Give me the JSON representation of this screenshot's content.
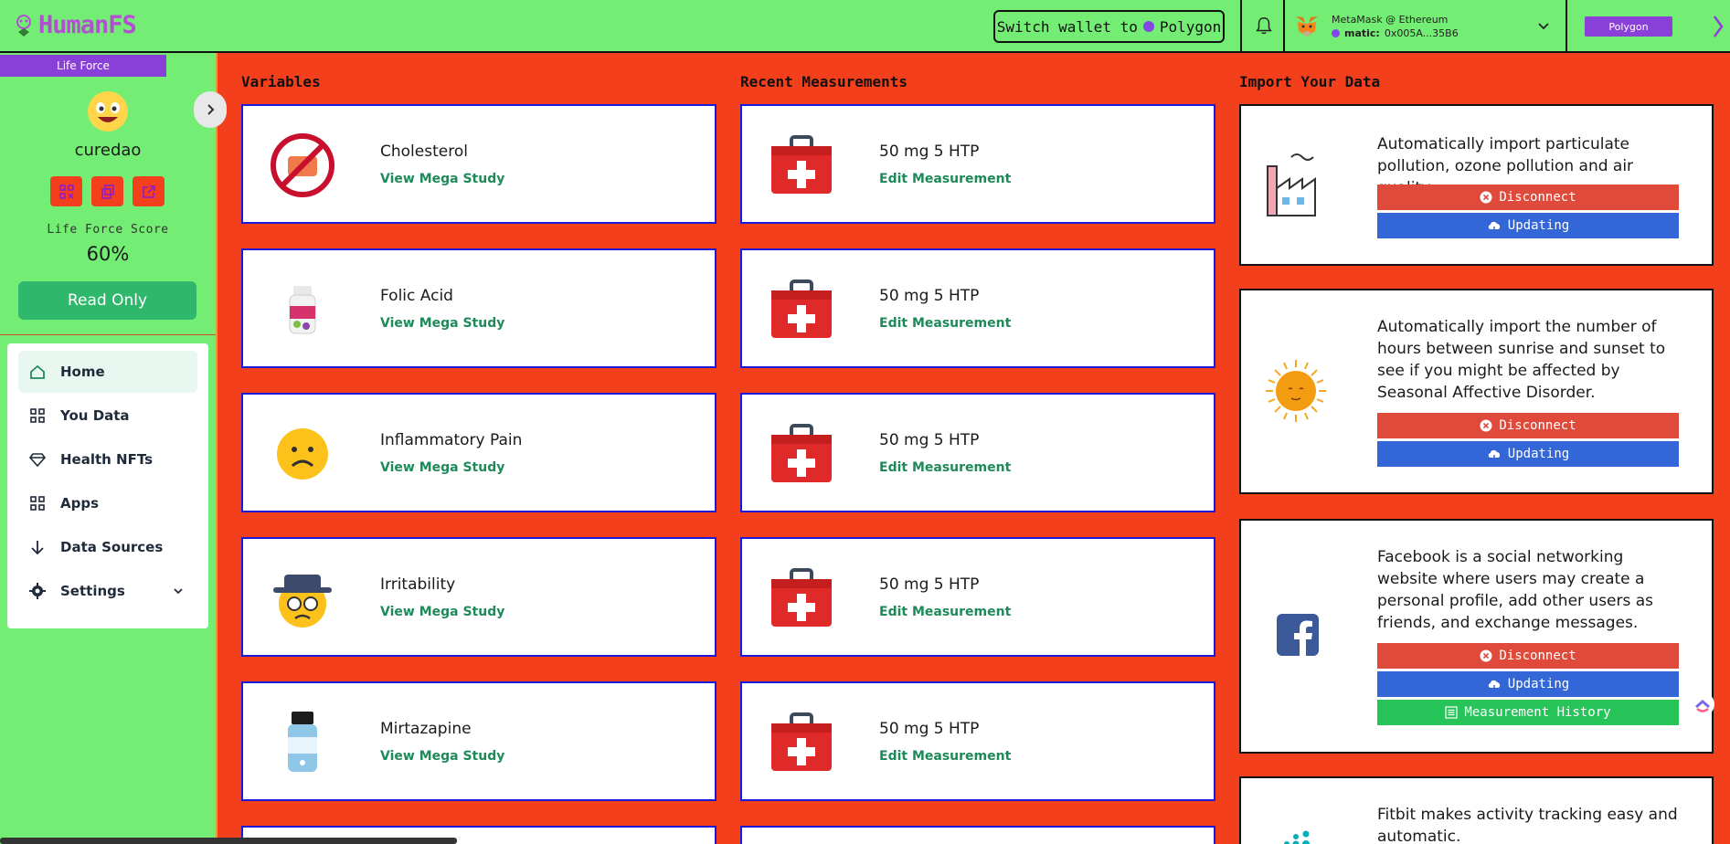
{
  "header": {
    "logo_text": "HumanFS",
    "switch_prefix": "Switch wallet to",
    "switch_network": "Polygon",
    "wallet_title": "MetaMask @ Ethereum",
    "wallet_network": "matic:",
    "wallet_address": "0x005A...35B6",
    "network_button": "Polygon"
  },
  "sidebar": {
    "tag": "Life Force",
    "username": "curedao",
    "score_label": "Life Force Score",
    "score_value": "60%",
    "read_only": "Read Only",
    "nav": [
      {
        "label": "Home",
        "icon": "home-icon"
      },
      {
        "label": "You Data",
        "icon": "grid-icon"
      },
      {
        "label": "Health NFTs",
        "icon": "diamond-icon"
      },
      {
        "label": "Apps",
        "icon": "apps-icon"
      },
      {
        "label": "Data Sources",
        "icon": "arrow-down-icon"
      },
      {
        "label": "Settings",
        "icon": "gear-icon"
      }
    ]
  },
  "variables": {
    "title": "Variables",
    "link_label": "View Mega Study",
    "items": [
      {
        "name": "Cholesterol",
        "icon": "no-food-icon"
      },
      {
        "name": "Folic Acid",
        "icon": "supplement-bottle-icon"
      },
      {
        "name": "Inflammatory Pain",
        "icon": "sad-face-icon"
      },
      {
        "name": "Irritability",
        "icon": "grumpy-face-icon"
      },
      {
        "name": "Mirtazapine",
        "icon": "pill-bottle-icon"
      }
    ]
  },
  "measurements": {
    "title": "Recent Measurements",
    "link_label": "Edit Measurement",
    "items": [
      {
        "name": "50 mg 5 HTP"
      },
      {
        "name": "50 mg 5 HTP"
      },
      {
        "name": "50 mg 5 HTP"
      },
      {
        "name": "50 mg 5 HTP"
      },
      {
        "name": "50 mg 5 HTP"
      }
    ]
  },
  "imports": {
    "title": "Import Your Data",
    "disconnect": "Disconnect",
    "updating": "Updating",
    "history": "Measurement History",
    "items": [
      {
        "desc": "Automatically import particulate pollution, ozone pollution and air quality.",
        "icon": "factory-icon"
      },
      {
        "desc": "Automatically import the number of hours between sunrise and sunset to see if you might be affected by Seasonal Affective Disorder.",
        "icon": "sun-icon"
      },
      {
        "desc": "Facebook is a social networking website where users may create a personal profile, add other users as friends, and exchange messages.",
        "icon": "facebook-icon"
      },
      {
        "desc": "Fitbit makes activity tracking easy and automatic.",
        "icon": "fitbit-icon"
      }
    ]
  },
  "colors": {
    "background": "#f43f1c",
    "header": "#73ed73",
    "accent_purple": "#8a3fd8",
    "link_green": "#1e8a5a",
    "card_border": "#1a1ad8"
  }
}
